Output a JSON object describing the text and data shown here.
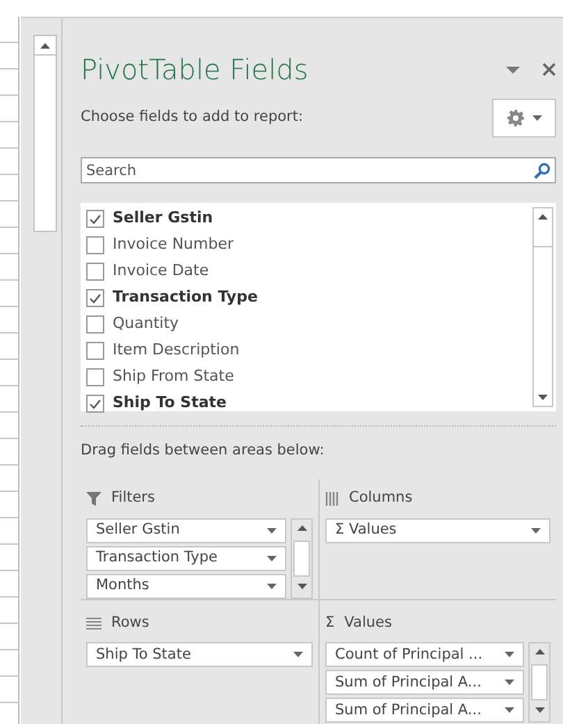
{
  "panel": {
    "title": "PivotTable Fields",
    "prompt": "Choose fields to add to report:",
    "search": {
      "placeholder": "Search"
    },
    "fields": [
      {
        "label": "Seller Gstin",
        "checked": true
      },
      {
        "label": "Invoice Number",
        "checked": false
      },
      {
        "label": "Invoice Date",
        "checked": false
      },
      {
        "label": "Transaction Type",
        "checked": true
      },
      {
        "label": "Quantity",
        "checked": false
      },
      {
        "label": "Item Description",
        "checked": false
      },
      {
        "label": "Ship From State",
        "checked": false
      },
      {
        "label": "Ship To State",
        "checked": true
      }
    ],
    "drag_hint": "Drag fields between areas below:",
    "areas": [
      {
        "kind": "filters",
        "title": "Filters",
        "items": [
          "Seller Gstin",
          "Transaction Type",
          "Months"
        ]
      },
      {
        "kind": "columns",
        "title": "Columns",
        "items": [
          "Σ Values"
        ]
      },
      {
        "kind": "rows",
        "title": "Rows",
        "items": [
          "Ship To State"
        ]
      },
      {
        "kind": "values",
        "glyph": "Σ",
        "title": "Values",
        "items": [
          "Count of Principal ...",
          "Sum of Principal A...",
          "Sum of Principal A..."
        ]
      }
    ]
  }
}
